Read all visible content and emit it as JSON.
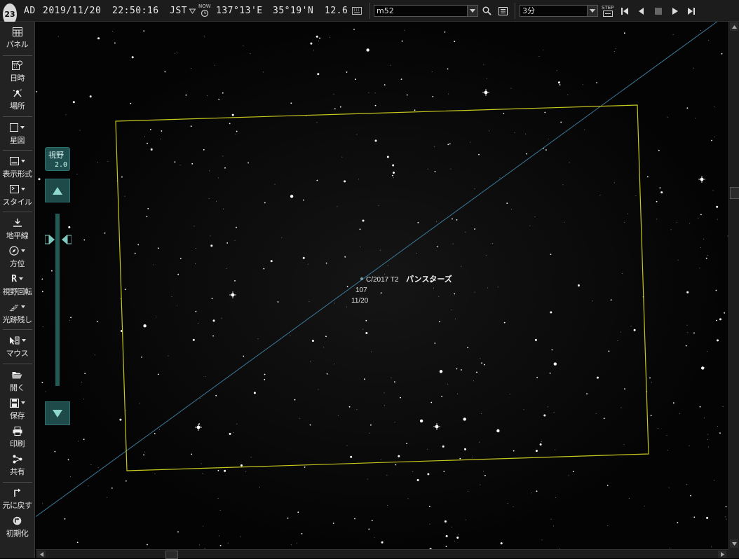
{
  "topbar": {
    "badge": "23",
    "era": "AD",
    "date": "2019/11/20",
    "time": "22:50:16",
    "timezone": "JST",
    "now_label": "NOW",
    "longitude": "137°13'E",
    "latitude": "35°19'N",
    "magnitude": "12.6",
    "search_value": "m52",
    "step_value": "3分",
    "step_label": "STEP"
  },
  "sidebar": {
    "items": [
      {
        "label": "パネル",
        "icon": "panel-icon"
      },
      {
        "label": "日時",
        "icon": "calendar-icon"
      },
      {
        "label": "場所",
        "icon": "location-icon"
      },
      {
        "label": "星図",
        "icon": "chart-frame-icon"
      },
      {
        "label": "表示形式",
        "icon": "display-icon"
      },
      {
        "label": "スタイル",
        "icon": "style-icon"
      },
      {
        "label": "地平線",
        "icon": "horizon-icon"
      },
      {
        "label": "方位",
        "icon": "compass-icon"
      },
      {
        "label": "視野回転",
        "icon": "rotate-icon"
      },
      {
        "label": "光跡残し",
        "icon": "trail-icon"
      },
      {
        "label": "マウス",
        "icon": "mouse-icon"
      },
      {
        "label": "開く",
        "icon": "open-folder-icon"
      },
      {
        "label": "保存",
        "icon": "save-icon"
      },
      {
        "label": "印刷",
        "icon": "print-icon"
      },
      {
        "label": "共有",
        "icon": "share-icon"
      },
      {
        "label": "元に戻す",
        "icon": "undo-icon"
      },
      {
        "label": "初期化",
        "icon": "reset-icon"
      }
    ]
  },
  "fov": {
    "label": "視野",
    "value": "2.0"
  },
  "sky": {
    "object_name": "C/2017 T2",
    "object_name_kana": "パンスターズ",
    "object_number": "107",
    "object_date": "11/20",
    "frame_color": "#c8c81e",
    "line_color": "#3a7a9a"
  }
}
